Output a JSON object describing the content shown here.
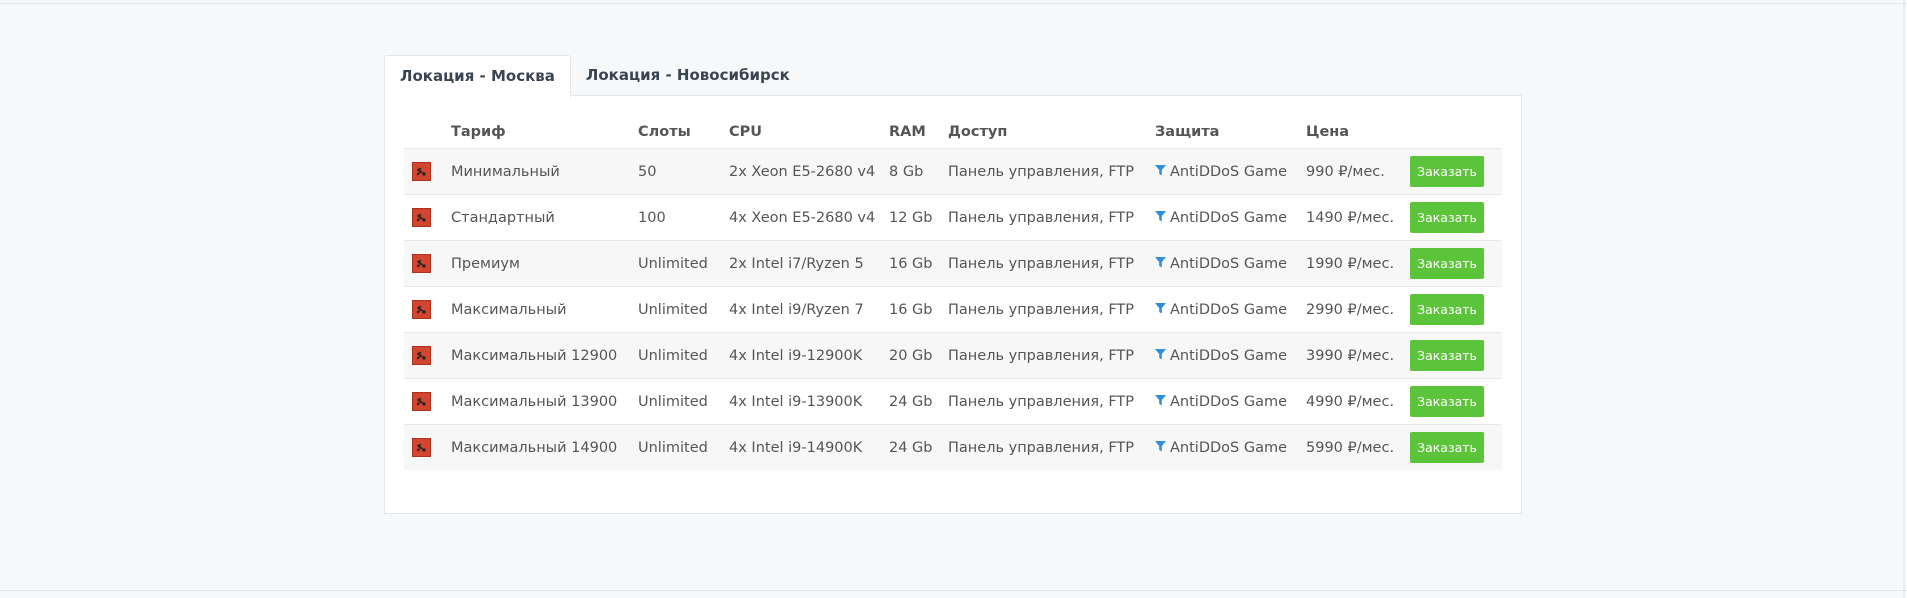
{
  "tabs": [
    {
      "label": "Локация - Москва",
      "active": true
    },
    {
      "label": "Локация - Новосибирск",
      "active": false
    }
  ],
  "table": {
    "headers": {
      "tariff": "Тариф",
      "slots": "Слоты",
      "cpu": "CPU",
      "ram": "RAM",
      "access": "Доступ",
      "protection": "Защита",
      "price": "Цена"
    },
    "rows": [
      {
        "tariff": "Минимальный",
        "slots": "50",
        "cpu": "2x Xeon E5-2680 v4",
        "ram": "8 Gb",
        "access": "Панель управления, FTP",
        "protection": "AntiDDoS Game",
        "price": "990 ₽/мес.",
        "button": "Заказать"
      },
      {
        "tariff": "Стандартный",
        "slots": "100",
        "cpu": "4x Xeon E5-2680 v4",
        "ram": "12 Gb",
        "access": "Панель управления, FTP",
        "protection": "AntiDDoS Game",
        "price": "1490 ₽/мес.",
        "button": "Заказать"
      },
      {
        "tariff": "Премиум",
        "slots": "Unlimited",
        "cpu": "2x Intel i7/Ryzen 5",
        "ram": "16 Gb",
        "access": "Панель управления, FTP",
        "protection": "AntiDDoS Game",
        "price": "1990 ₽/мес.",
        "button": "Заказать"
      },
      {
        "tariff": "Максимальный",
        "slots": "Unlimited",
        "cpu": "4x Intel i9/Ryzen 7",
        "ram": "16 Gb",
        "access": "Панель управления, FTP",
        "protection": "AntiDDoS Game",
        "price": "2990 ₽/мес.",
        "button": "Заказать"
      },
      {
        "tariff": "Максимальный 12900",
        "slots": "Unlimited",
        "cpu": "4x Intel i9-12900K",
        "ram": "20 Gb",
        "access": "Панель управления, FTP",
        "protection": "AntiDDoS Game",
        "price": "3990 ₽/мес.",
        "button": "Заказать"
      },
      {
        "tariff": "Максимальный 13900",
        "slots": "Unlimited",
        "cpu": "4x Intel i9-13900K",
        "ram": "24 Gb",
        "access": "Панель управления, FTP",
        "protection": "AntiDDoS Game",
        "price": "4990 ₽/мес.",
        "button": "Заказать"
      },
      {
        "tariff": "Максимальный 14900",
        "slots": "Unlimited",
        "cpu": "4x Intel i9-14900K",
        "ram": "24 Gb",
        "access": "Панель управления, FTP",
        "protection": "AntiDDoS Game",
        "price": "5990 ₽/мес.",
        "button": "Заказать"
      }
    ]
  },
  "icons": {
    "game": "game-logo-icon",
    "protection": "filter-icon"
  },
  "colors": {
    "order_button": "#5cc43a",
    "game_icon": "#d2452f",
    "filter_icon": "#2f8fdc"
  }
}
